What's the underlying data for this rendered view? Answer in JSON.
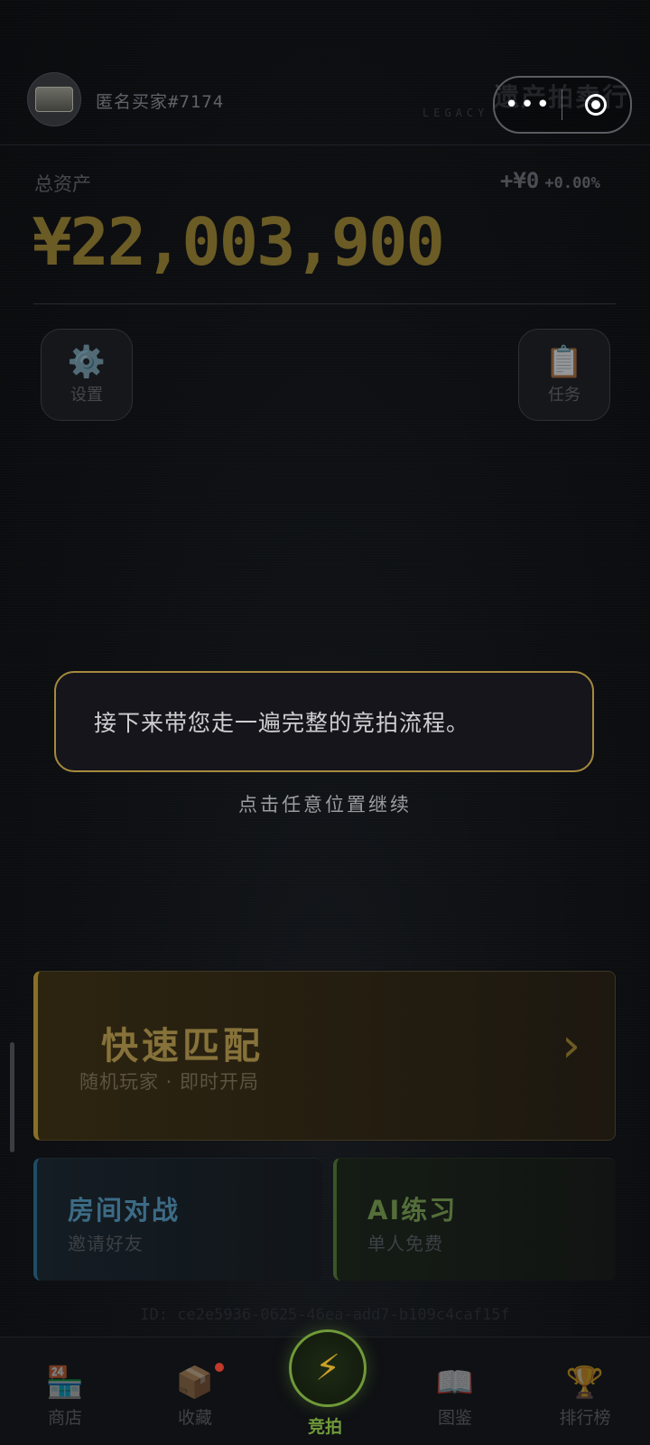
{
  "header": {
    "username": "匿名买家#7174",
    "brand_title": "遗产拍卖行",
    "brand_subtitle": "LEGACY",
    "capsule_more": "•••"
  },
  "assets": {
    "label": "总资产",
    "total": "¥22,003,900",
    "change": "+¥0",
    "change_pct": "+0.00%"
  },
  "side_buttons": {
    "settings_label": "设置",
    "tasks_label": "任务"
  },
  "tutorial": {
    "message": "接下来带您走一遍完整的竞拍流程。",
    "hint": "点击任意位置继续"
  },
  "modes": {
    "quick_match": {
      "title": "快速匹配",
      "subtitle": "随机玩家 · 即时开局",
      "arrow": "›"
    },
    "room_battle": {
      "title": "房间对战",
      "subtitle": "邀请好友"
    },
    "ai_practice": {
      "title": "AI练习",
      "subtitle": "单人免费"
    }
  },
  "session_id": "ID: ce2e5936-0625-46ea-add7-b109c4caf15f",
  "bottom_nav": {
    "shop": "商店",
    "collection": "收藏",
    "auction": "竞拍",
    "gallery": "图鉴",
    "leaderboard": "排行榜"
  },
  "icons": {
    "settings": "⚙️",
    "tasks": "📋",
    "shop": "🏪",
    "collection": "📦",
    "auction": "⚡",
    "gallery": "📖",
    "leaderboard": "🏆"
  },
  "colors": {
    "gold_accent": "#a58a3e",
    "active_green": "#6f9a39",
    "room_blue": "#3c6b85",
    "ai_green": "#546e3a"
  }
}
